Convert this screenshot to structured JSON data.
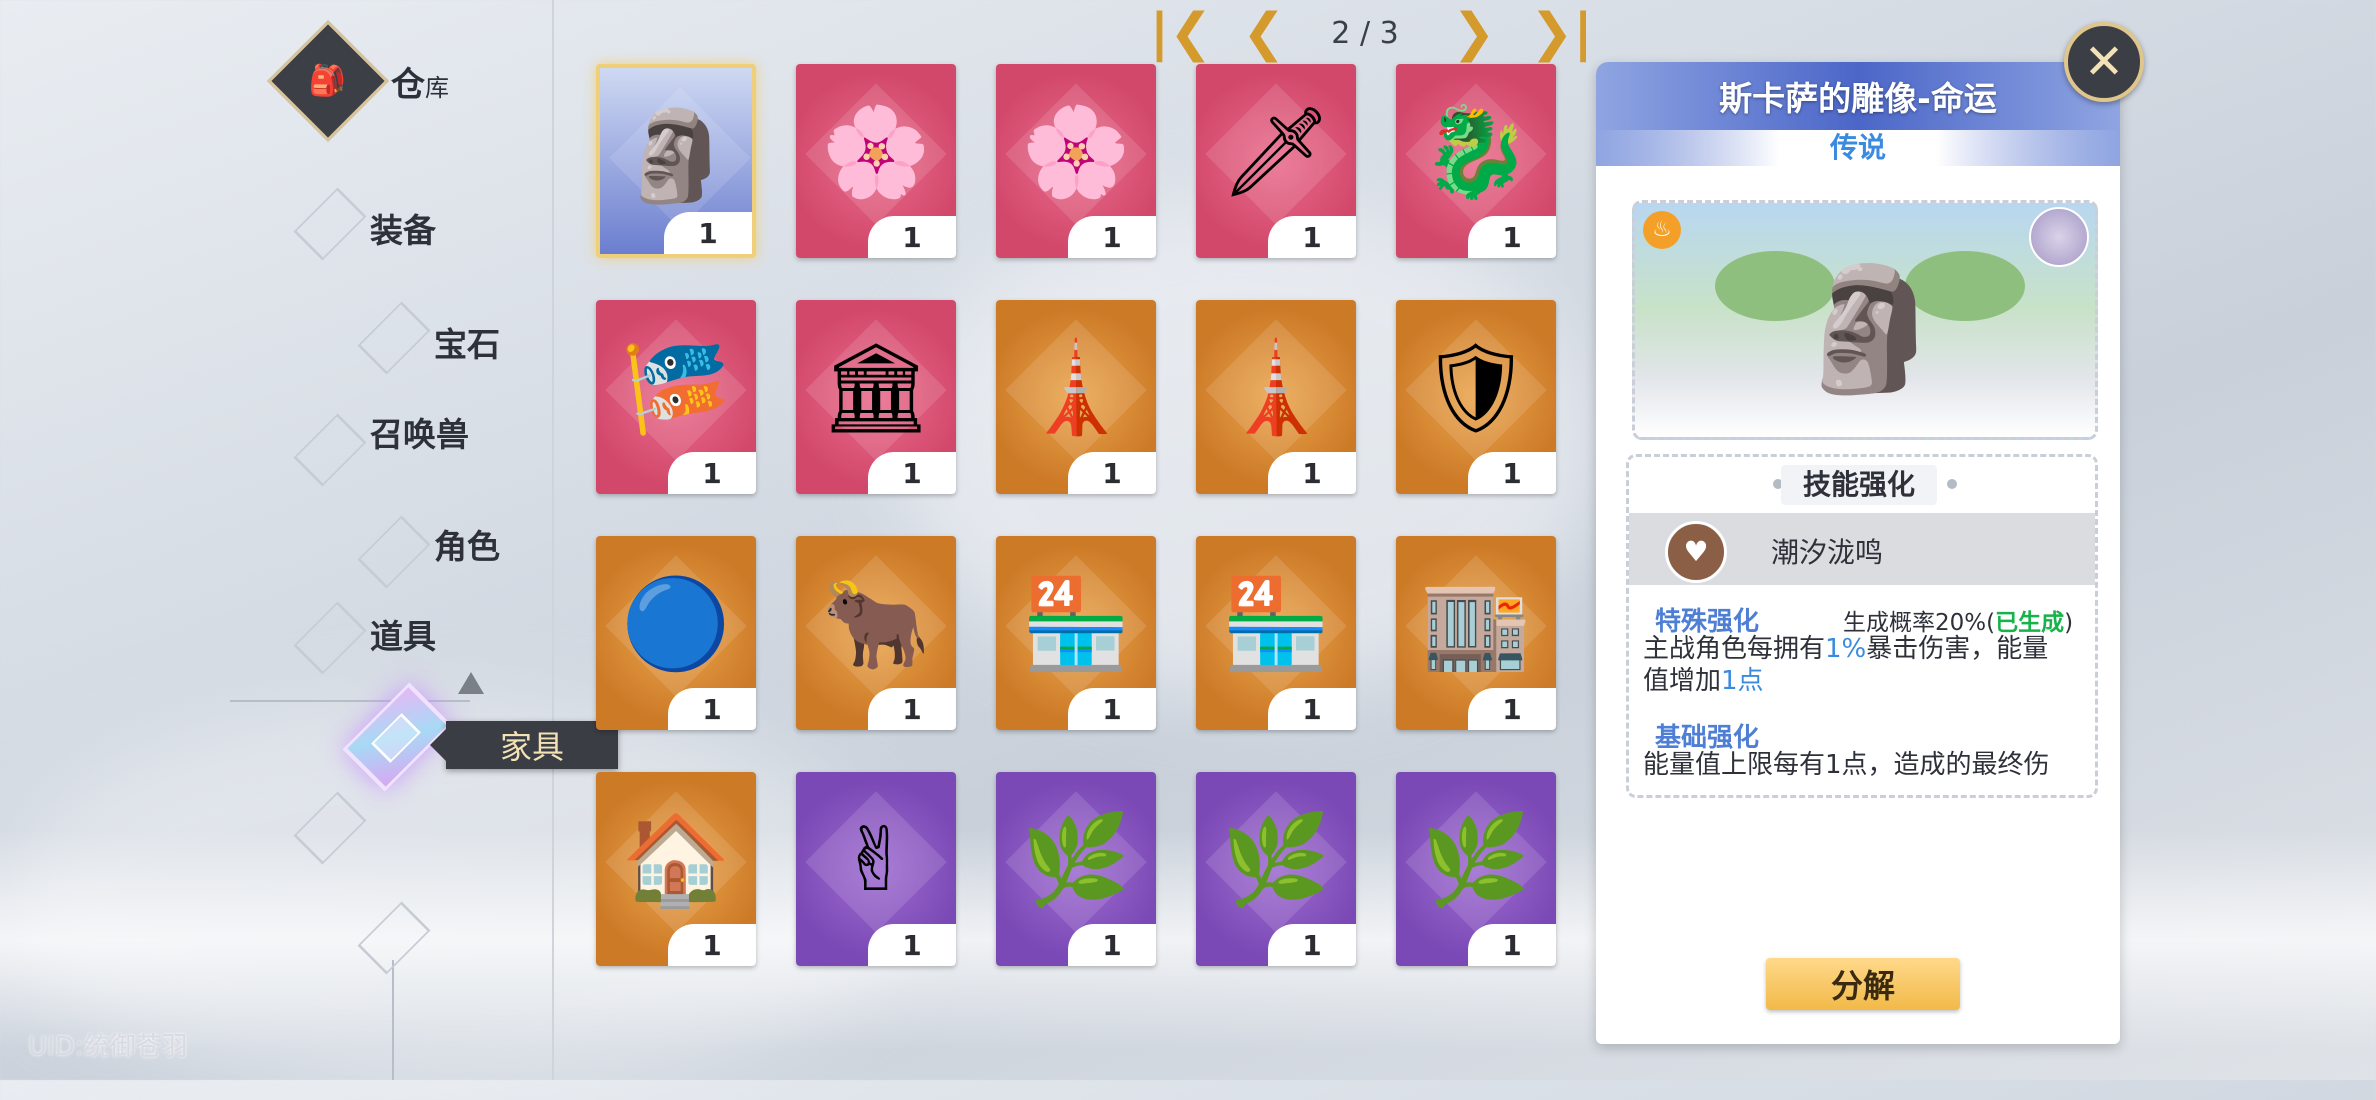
{
  "header": {
    "section_name": "仓",
    "section_suffix": "库",
    "brand_glyph": "🎒"
  },
  "nav": {
    "items": [
      {
        "id": "equipment",
        "label": "装备"
      },
      {
        "id": "gem",
        "label": "宝石"
      },
      {
        "id": "summon",
        "label": "召唤兽"
      },
      {
        "id": "character",
        "label": "角色"
      },
      {
        "id": "props",
        "label": "道具"
      }
    ],
    "active": "家具"
  },
  "uid": "UID:统御苍羽",
  "pager": {
    "current": "2",
    "separator": "/",
    "total": "3"
  },
  "grid": {
    "items": [
      {
        "name": "statue-skasa",
        "color": "blueframe",
        "icon": "🗿",
        "count": "1"
      },
      {
        "name": "sakura-tree",
        "color": "pink",
        "icon": "🌸",
        "count": "1"
      },
      {
        "name": "sakura-tree",
        "color": "pink",
        "icon": "🌸",
        "count": "1"
      },
      {
        "name": "weapon-rack",
        "color": "pink",
        "icon": "🗡",
        "count": "1"
      },
      {
        "name": "dragon-weathervane",
        "color": "pink",
        "icon": "🐉",
        "count": "1"
      },
      {
        "name": "banner",
        "color": "pink",
        "icon": "🎏",
        "count": "1"
      },
      {
        "name": "mansion",
        "color": "pink",
        "icon": "🏛",
        "count": "1"
      },
      {
        "name": "obelisk",
        "color": "orange",
        "icon": "🗼",
        "count": "1"
      },
      {
        "name": "obelisk",
        "color": "orange",
        "icon": "🗼",
        "count": "1"
      },
      {
        "name": "gold-emblem",
        "color": "orange",
        "icon": "🛡",
        "count": "1"
      },
      {
        "name": "blue-emblem",
        "color": "orange",
        "icon": "🔵",
        "count": "1"
      },
      {
        "name": "ox-board",
        "color": "orange",
        "icon": "🐂",
        "count": "1"
      },
      {
        "name": "meat-shop",
        "color": "orange",
        "icon": "🏪",
        "count": "1"
      },
      {
        "name": "meat-shop",
        "color": "orange",
        "icon": "🏪",
        "count": "1"
      },
      {
        "name": "book-shop",
        "color": "orange",
        "icon": "🏬",
        "count": "1"
      },
      {
        "name": "flower-shop",
        "color": "orange",
        "icon": "🏠",
        "count": "1"
      },
      {
        "name": "peace-hand",
        "color": "purple",
        "icon": "✌",
        "count": "1"
      },
      {
        "name": "flower-planter-blue",
        "color": "purple",
        "icon": "🌿",
        "count": "1"
      },
      {
        "name": "flower-planter-green",
        "color": "purple",
        "icon": "🌿",
        "count": "1"
      },
      {
        "name": "flower-planter-teal",
        "color": "purple",
        "icon": "🌿",
        "count": "1"
      }
    ]
  },
  "detail": {
    "title": "斯卡萨的雕像-命运",
    "rarity": "传说",
    "preview_icon": "🗿",
    "skill_header": "技能强化",
    "skill_name": "潮汐泷鸣",
    "special_title": "特殊强化",
    "special_meta_prefix": "生成概率20%(",
    "special_meta_status": "已生成",
    "special_meta_suffix": ")",
    "special_desc_a": "主战角色每拥有",
    "special_desc_hl1": "1%",
    "special_desc_b": "暴击伤害，能量",
    "special_desc_c": "值增加",
    "special_desc_hl2": "1点",
    "basic_title": "基础强化",
    "basic_desc": "能量值上限每有1点，造成的最终伤",
    "decompose_label": "分解",
    "close_glyph": "✕"
  },
  "colors": {
    "accent_gold": "#d49a2c",
    "rarity_blue": "#3a8be0",
    "generated_green": "#17b34a"
  }
}
